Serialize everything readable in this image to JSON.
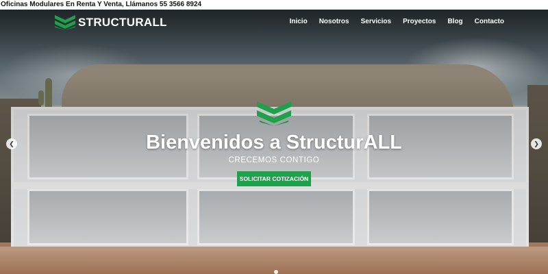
{
  "topbar": {
    "text": "Oficinas Modulares En Renta Y Venta, Llámanos 55 3566 8924"
  },
  "brand": {
    "name": "STRUCTURALL",
    "accent": "#1fa04a"
  },
  "nav": {
    "items": [
      {
        "label": "Inicio"
      },
      {
        "label": "Nosotros"
      },
      {
        "label": "Servicios"
      },
      {
        "label": "Proyectos"
      },
      {
        "label": "Blog"
      },
      {
        "label": "Contacto"
      }
    ]
  },
  "hero": {
    "title": "Bienvenidos a StructurALL",
    "subtitle": "CRECEMOS CONTIGO",
    "cta_label": "SOLICITAR COTIZACIÓN",
    "prev_icon": "chevron-left-icon",
    "next_icon": "chevron-right-icon"
  }
}
